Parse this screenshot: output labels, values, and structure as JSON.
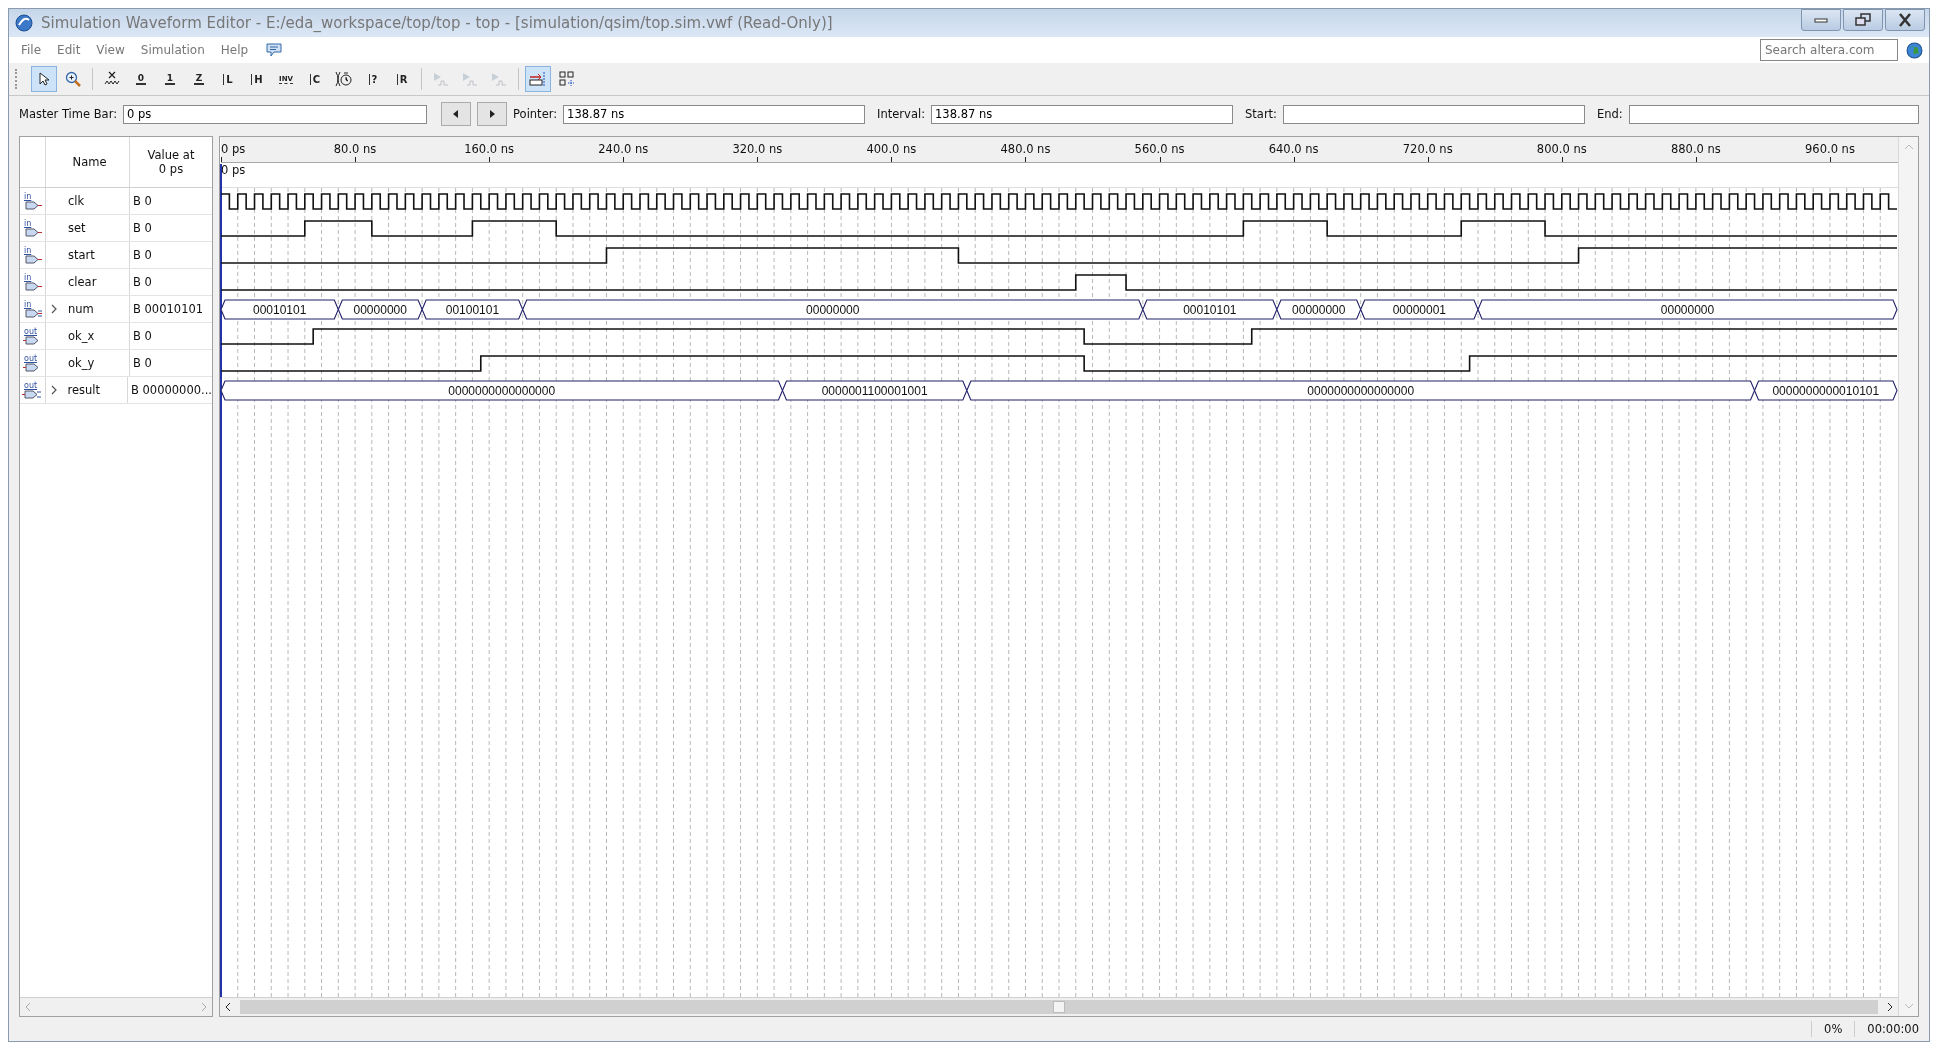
{
  "window": {
    "title": "Simulation Waveform Editor - E:/eda_workspace/top/top - top - [simulation/qsim/top.sim.vwf (Read-Only)]"
  },
  "menu": [
    "File",
    "Edit",
    "View",
    "Simulation",
    "Help"
  ],
  "search": {
    "placeholder": "Search altera.com"
  },
  "toolbar": [
    {
      "kind": "pointer",
      "selected": true,
      "disabled": false
    },
    {
      "kind": "zoom",
      "selected": false,
      "disabled": false
    },
    {
      "kind": "sep"
    },
    {
      "kind": "unknown",
      "selected": false,
      "disabled": false
    },
    {
      "kind": "level",
      "label": "0",
      "selected": false,
      "disabled": false
    },
    {
      "kind": "level",
      "label": "1",
      "selected": false,
      "disabled": false
    },
    {
      "kind": "level",
      "label": "Z",
      "selected": false,
      "disabled": false
    },
    {
      "kind": "cross",
      "label": "L",
      "selected": false,
      "disabled": false
    },
    {
      "kind": "cross",
      "label": "H",
      "selected": false,
      "disabled": false
    },
    {
      "kind": "invert",
      "label": "INV",
      "selected": false,
      "disabled": false
    },
    {
      "kind": "cross",
      "label": "C",
      "selected": false,
      "disabled": false
    },
    {
      "kind": "clock",
      "selected": false,
      "disabled": false
    },
    {
      "kind": "cross",
      "label": "?",
      "selected": false,
      "disabled": false
    },
    {
      "kind": "cross",
      "label": "R",
      "selected": false,
      "disabled": false
    },
    {
      "kind": "sep"
    },
    {
      "kind": "simulate",
      "selected": false,
      "disabled": true
    },
    {
      "kind": "simulate",
      "selected": false,
      "disabled": true
    },
    {
      "kind": "simulate",
      "selected": false,
      "disabled": true
    },
    {
      "kind": "sep"
    },
    {
      "kind": "snap",
      "selected": true,
      "disabled": false
    },
    {
      "kind": "grid",
      "selected": false,
      "disabled": false
    }
  ],
  "time_bar": {
    "master_label": "Master Time Bar:",
    "master": "0 ps",
    "pointer_label": "Pointer:",
    "pointer": "138.87 ns",
    "interval_label": "Interval:",
    "interval": "138.87 ns",
    "start_label": "Start:",
    "end_label": "End:"
  },
  "columns": {
    "name": "Name",
    "value": "Value at 0 ps"
  },
  "signals": [
    {
      "dir": "in",
      "bus": false,
      "name": "clk",
      "value": "B 0"
    },
    {
      "dir": "in",
      "bus": false,
      "name": "set",
      "value": "B 0"
    },
    {
      "dir": "in",
      "bus": false,
      "name": "start",
      "value": "B 0"
    },
    {
      "dir": "in",
      "bus": false,
      "name": "clear",
      "value": "B 0"
    },
    {
      "dir": "in",
      "bus": true,
      "name": "num",
      "value": "B 00010101",
      "segments": [
        "00010101",
        "00000000",
        "00100101",
        "00000000",
        "00010101",
        "00000000",
        "00000001",
        "00000000"
      ]
    },
    {
      "dir": "out",
      "bus": false,
      "name": "ok_x",
      "value": "B 0"
    },
    {
      "dir": "out",
      "bus": false,
      "name": "ok_y",
      "value": "B 0"
    },
    {
      "dir": "out",
      "bus": true,
      "name": "result",
      "value": "B 00000000...",
      "segments": [
        "0000000000000000",
        "0000001100001001",
        "0000000000000000",
        "0000000000010101"
      ]
    }
  ],
  "waveforms": {
    "ticks": [
      "0 ps",
      "80.0 ns",
      "160.0 ns",
      "240.0 ns",
      "320.0 ns",
      "400.0 ns",
      "480.0 ns",
      "560.0 ns",
      "640.0 ns",
      "720.0 ns",
      "800.0 ns",
      "880.0 ns",
      "960.0 ns"
    ],
    "master_marker": "0 ps"
  },
  "status_bar": {
    "progress": "0%",
    "elapsed": "00:00:00"
  }
}
